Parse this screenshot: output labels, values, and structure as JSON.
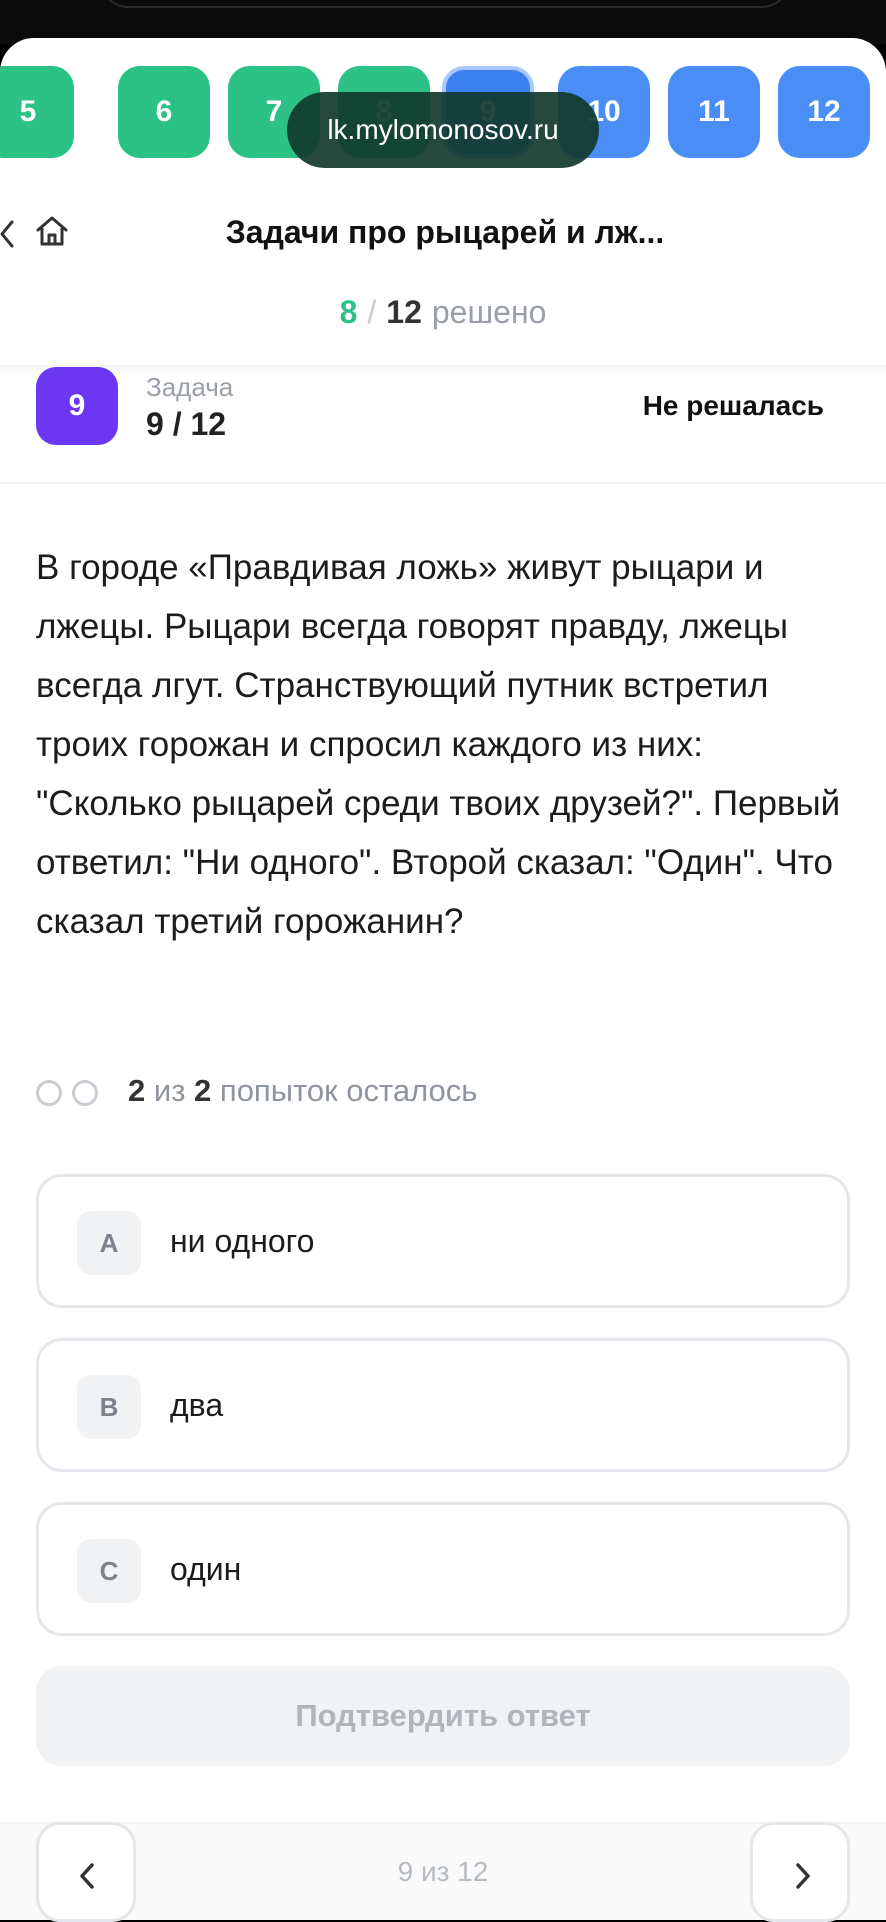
{
  "browser": {
    "url": "lk.mylomonosov.ru"
  },
  "tabs": [
    {
      "label": "5",
      "state": "solved"
    },
    {
      "label": "6",
      "state": "solved"
    },
    {
      "label": "7",
      "state": "solved"
    },
    {
      "label": "8",
      "state": "solved"
    },
    {
      "label": "9",
      "state": "current"
    },
    {
      "label": "10",
      "state": "unsolved"
    },
    {
      "label": "11",
      "state": "unsolved"
    },
    {
      "label": "12",
      "state": "unsolved"
    }
  ],
  "header": {
    "title": "Задачи про рыцарей и лж..."
  },
  "progress": {
    "solved": "8",
    "separator": "/",
    "total": "12",
    "label": "решено"
  },
  "task": {
    "badge": "9",
    "label": "Задача",
    "number": "9 / 12",
    "status": "Не решалась"
  },
  "problem": {
    "text": "В городе «Правдивая ложь» живут рыцари и лжецы. Рыцари всегда говорят правду, лжецы всегда лгут. Странствующий путник встретил троих горожан и спросил каждого из них: \"Сколько рыцарей среди твоих друзей?\". Первый ответил: \"Ни одного\". Второй сказал: \"Один\". Что сказал третий горожанин?"
  },
  "attempts": {
    "left": "2",
    "of": "из",
    "total": "2",
    "suffix": "попыток осталось"
  },
  "options": [
    {
      "letter": "A",
      "text": "ни одного"
    },
    {
      "letter": "B",
      "text": "два"
    },
    {
      "letter": "C",
      "text": "один"
    }
  ],
  "confirm": {
    "label": "Подтвердить ответ"
  },
  "footer": {
    "pager": "9 из 12"
  },
  "colors": {
    "solved": "#2cc185",
    "unsolved": "#4a8ef5",
    "current": "#3b7ff0",
    "task_badge": "#6c37f2"
  }
}
